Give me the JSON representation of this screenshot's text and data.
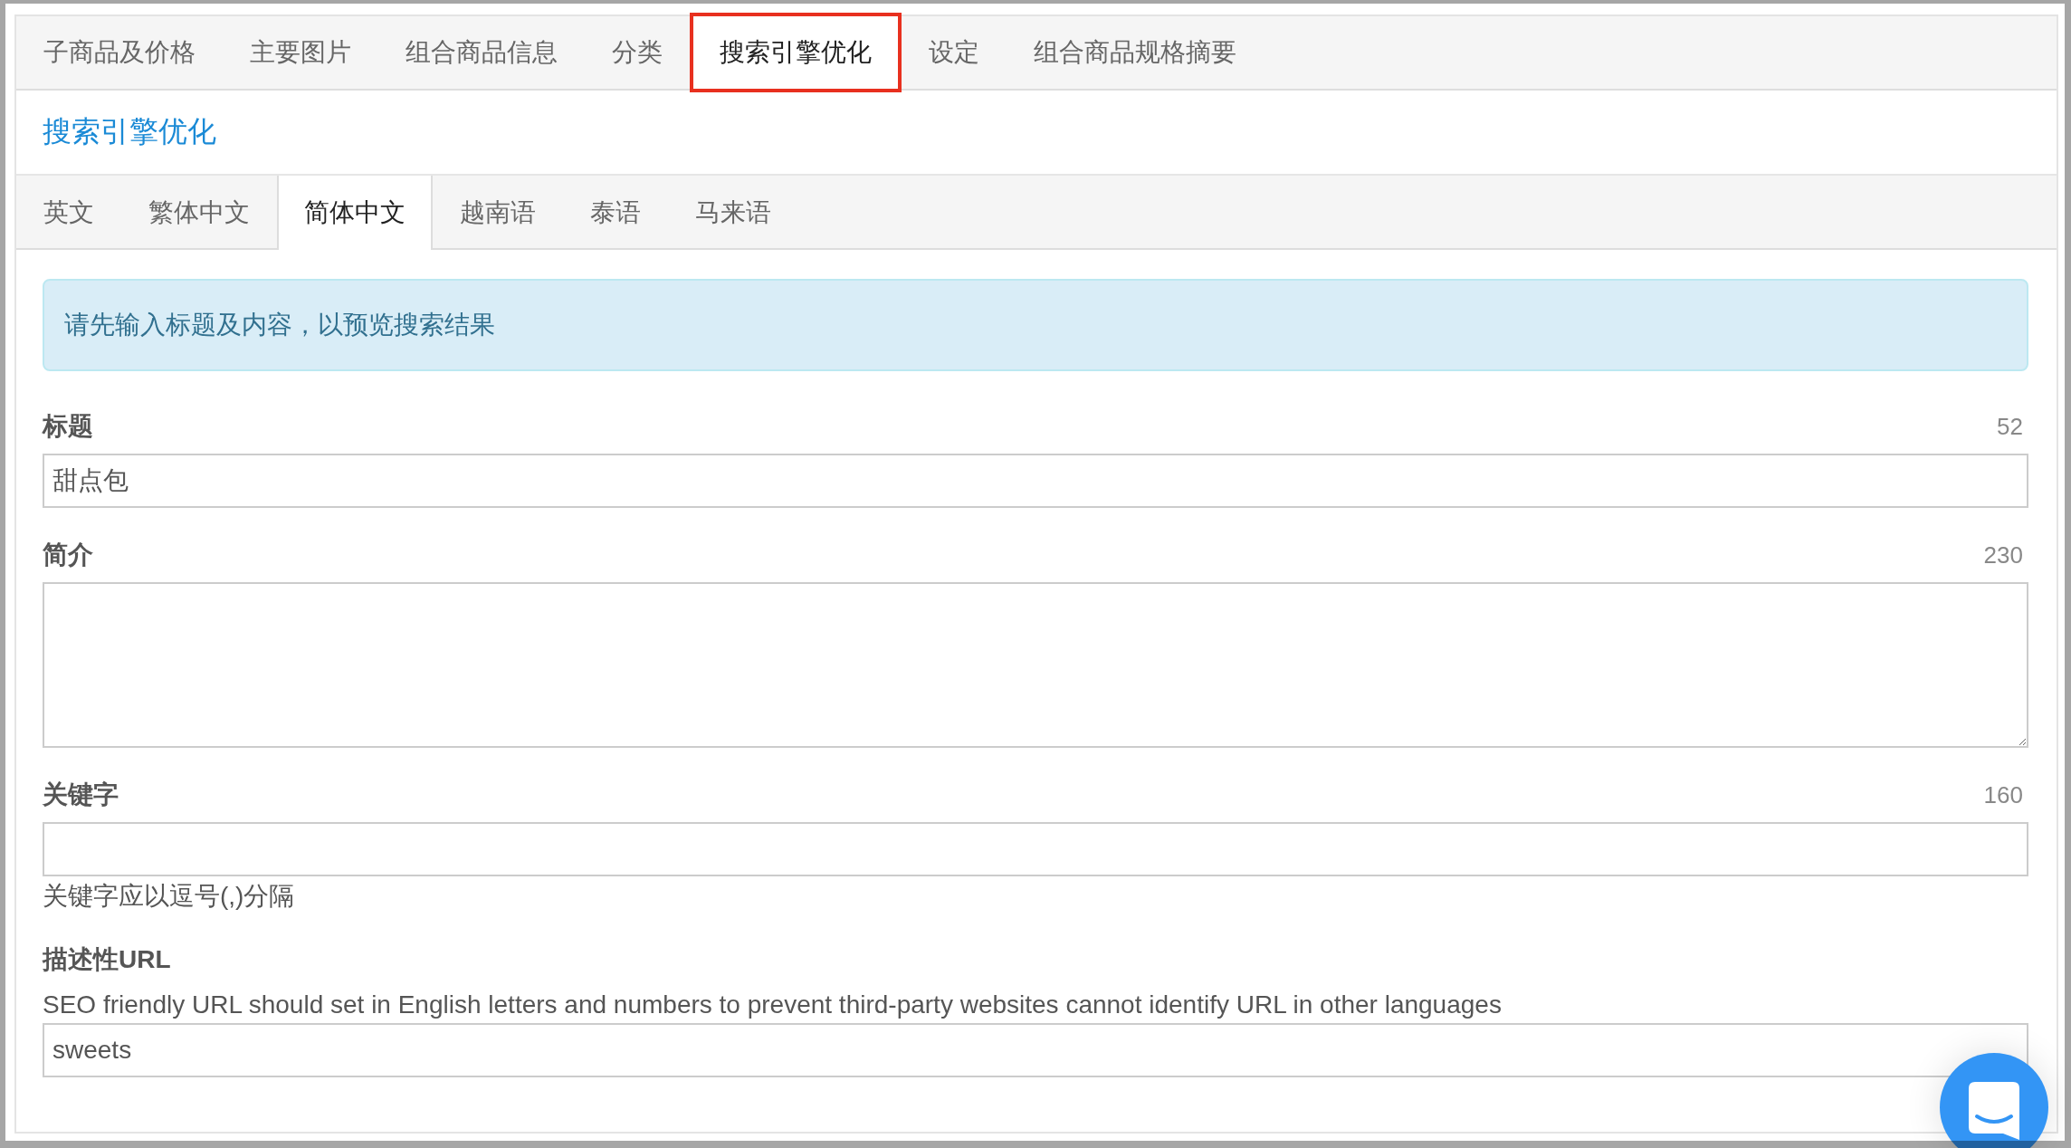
{
  "top_tabs": [
    {
      "label": "子商品及价格",
      "selected": false,
      "highlighted": false
    },
    {
      "label": "主要图片",
      "selected": false,
      "highlighted": false
    },
    {
      "label": "组合商品信息",
      "selected": false,
      "highlighted": false
    },
    {
      "label": "分类",
      "selected": false,
      "highlighted": false
    },
    {
      "label": "搜索引擎优化",
      "selected": true,
      "highlighted": true
    },
    {
      "label": "设定",
      "selected": false,
      "highlighted": false
    },
    {
      "label": "组合商品规格摘要",
      "selected": false,
      "highlighted": false
    }
  ],
  "section_title": "搜索引擎优化",
  "language_tabs": [
    {
      "label": "英文",
      "selected": false
    },
    {
      "label": "繁体中文",
      "selected": false
    },
    {
      "label": "简体中文",
      "selected": true
    },
    {
      "label": "越南语",
      "selected": false
    },
    {
      "label": "泰语",
      "selected": false
    },
    {
      "label": "马来语",
      "selected": false
    }
  ],
  "alert": "请先输入标题及内容，以预览搜索结果",
  "fields": [
    {
      "kind": "input",
      "label": "标题",
      "counter": "52",
      "value": "甜点包"
    },
    {
      "kind": "textarea",
      "label": "简介",
      "counter": "230"
    },
    {
      "kind": "input",
      "label": "关键字",
      "counter": "160",
      "help": "关键字应以逗号(,)分隔"
    },
    {
      "kind": "input",
      "label": "描述性URL",
      "description": "SEO friendly URL should set in English letters and numbers to prevent third-party websites cannot identify URL in other languages",
      "value": "sweets"
    }
  ]
}
